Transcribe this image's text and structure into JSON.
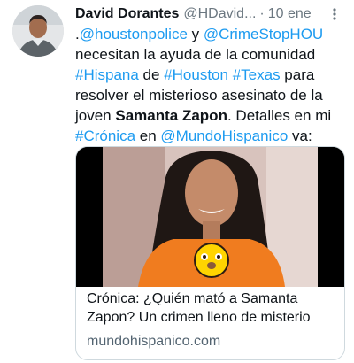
{
  "tweet": {
    "author_name": "David Dorantes",
    "author_handle": "@HDavid...",
    "separator": "·",
    "date": "10 ene",
    "more_icon": "vertical-dots-icon",
    "body": {
      "prefix": ".",
      "mention_1": "@houstonpolice",
      "word_y": " y ",
      "mention_2": "@CrimeStopHOU",
      "text_1": " necesitan la ayuda de la comunidad ",
      "hashtag_1": "#Hispana",
      "word_de": " de ",
      "hashtag_2": "#Houston",
      "space": " ",
      "hashtag_3": "#Texas",
      "text_2": " para resolver el misterioso asesinato de la joven ",
      "name_bold": "Samanta Zapon",
      "text_3": ". Detalles en mi ",
      "hashtag_4": "#Crónica",
      "word_en": " en ",
      "mention_3": "@MundoHispanico",
      "text_4": " va:"
    },
    "card": {
      "title": "Crónica: ¿Quién mató a Samanta Zapon? Un crimen lleno de misterio",
      "domain": "mundohispanico.com"
    }
  },
  "colors": {
    "link": "#1d9bf0",
    "text": "#0f1419",
    "muted": "#6b7780",
    "border": "#cfd9de",
    "shirt": "#f07c1f"
  }
}
